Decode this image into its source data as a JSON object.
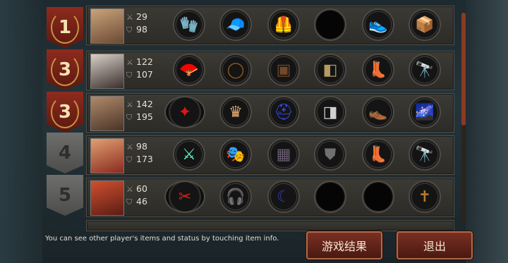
{
  "rows": [
    {
      "rank": "1",
      "rank_style": "gold",
      "attack": "29",
      "defense": "98",
      "items": [
        "gloves-icon",
        "cap-icon",
        "vest-icon",
        "empty",
        "sneakers-icon",
        "box-icon"
      ]
    },
    {
      "rank": "3",
      "rank_style": "gold",
      "attack": "122",
      "defense": "107",
      "items": [
        "fan-icon",
        "ring-icon",
        "armor-icon",
        "gauntlet-icon",
        "boots-icon",
        "binoculars-icon"
      ]
    },
    {
      "rank": "3",
      "rank_style": "gold",
      "attack": "142",
      "defense": "195",
      "items": [
        "red-armor-icon",
        "tiara-icon",
        "blue-helmet-icon",
        "silver-gauntlet-icon",
        "brown-boots-icon",
        "galaxy-icon"
      ]
    },
    {
      "rank": "4",
      "rank_style": "grey",
      "attack": "98",
      "defense": "173",
      "items": [
        "twin-blades-icon",
        "mask-icon",
        "stone-armor-icon",
        "shield-icon",
        "boots-icon",
        "binoculars-icon"
      ]
    },
    {
      "rank": "5",
      "rank_style": "grey",
      "attack": "60",
      "defense": "46",
      "items": [
        "chainsaw-icon",
        "headset-icon",
        "cloak-icon",
        "empty",
        "empty",
        "cross-icon"
      ]
    }
  ],
  "hint": "You can see other player's items and status by touching item info.",
  "buttons": {
    "result": "游戏结果",
    "exit": "退出"
  }
}
